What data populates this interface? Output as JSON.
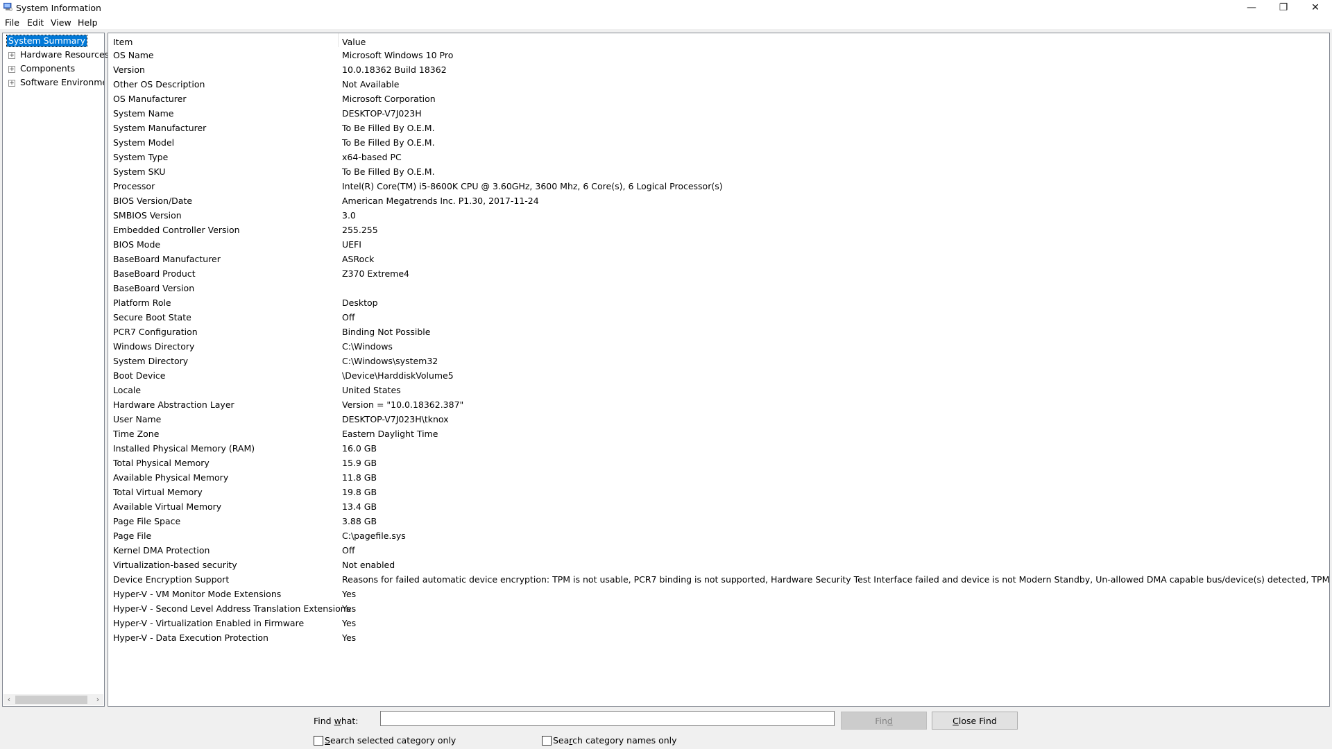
{
  "window": {
    "title": "System Information",
    "controls": {
      "minimize": "—",
      "restore": "❐",
      "close": "✕"
    }
  },
  "menu": [
    {
      "label": "File"
    },
    {
      "label": "Edit"
    },
    {
      "label": "View"
    },
    {
      "label": "Help"
    }
  ],
  "tree": {
    "selected": "System Summary",
    "items": [
      {
        "label": "Hardware Resources",
        "expander": "+"
      },
      {
        "label": "Components",
        "expander": "+"
      },
      {
        "label": "Software Environmer",
        "expander": "+"
      }
    ],
    "scroll_left": "‹",
    "scroll_right": "›"
  },
  "list": {
    "columns": {
      "item": "Item",
      "value": "Value"
    },
    "rows": [
      {
        "item": "OS Name",
        "value": "Microsoft Windows 10 Pro"
      },
      {
        "item": "Version",
        "value": "10.0.18362 Build 18362"
      },
      {
        "item": "Other OS Description",
        "value": "Not Available"
      },
      {
        "item": "OS Manufacturer",
        "value": "Microsoft Corporation"
      },
      {
        "item": "System Name",
        "value": "DESKTOP-V7J023H"
      },
      {
        "item": "System Manufacturer",
        "value": "To Be Filled By O.E.M."
      },
      {
        "item": "System Model",
        "value": "To Be Filled By O.E.M."
      },
      {
        "item": "System Type",
        "value": "x64-based PC"
      },
      {
        "item": "System SKU",
        "value": "To Be Filled By O.E.M."
      },
      {
        "item": "Processor",
        "value": "Intel(R) Core(TM) i5-8600K CPU @ 3.60GHz, 3600 Mhz, 6 Core(s), 6 Logical Processor(s)"
      },
      {
        "item": "BIOS Version/Date",
        "value": "American Megatrends Inc. P1.30, 2017-11-24"
      },
      {
        "item": "SMBIOS Version",
        "value": "3.0"
      },
      {
        "item": "Embedded Controller Version",
        "value": "255.255"
      },
      {
        "item": "BIOS Mode",
        "value": "UEFI"
      },
      {
        "item": "BaseBoard Manufacturer",
        "value": "ASRock"
      },
      {
        "item": "BaseBoard Product",
        "value": "Z370 Extreme4"
      },
      {
        "item": "BaseBoard Version",
        "value": ""
      },
      {
        "item": "Platform Role",
        "value": "Desktop"
      },
      {
        "item": "Secure Boot State",
        "value": "Off"
      },
      {
        "item": "PCR7 Configuration",
        "value": "Binding Not Possible"
      },
      {
        "item": "Windows Directory",
        "value": "C:\\Windows"
      },
      {
        "item": "System Directory",
        "value": "C:\\Windows\\system32"
      },
      {
        "item": "Boot Device",
        "value": "\\Device\\HarddiskVolume5"
      },
      {
        "item": "Locale",
        "value": "United States"
      },
      {
        "item": "Hardware Abstraction Layer",
        "value": "Version = \"10.0.18362.387\""
      },
      {
        "item": "User Name",
        "value": "DESKTOP-V7J023H\\tknox"
      },
      {
        "item": "Time Zone",
        "value": "Eastern Daylight Time"
      },
      {
        "item": "Installed Physical Memory (RAM)",
        "value": "16.0 GB"
      },
      {
        "item": "Total Physical Memory",
        "value": "15.9 GB"
      },
      {
        "item": "Available Physical Memory",
        "value": "11.8 GB"
      },
      {
        "item": "Total Virtual Memory",
        "value": "19.8 GB"
      },
      {
        "item": "Available Virtual Memory",
        "value": "13.4 GB"
      },
      {
        "item": "Page File Space",
        "value": "3.88 GB"
      },
      {
        "item": "Page File",
        "value": "C:\\pagefile.sys"
      },
      {
        "item": "Kernel DMA Protection",
        "value": "Off"
      },
      {
        "item": "Virtualization-based security",
        "value": "Not enabled"
      },
      {
        "item": "Device Encryption Support",
        "value": "Reasons for failed automatic device encryption: TPM is not usable, PCR7 binding is not supported, Hardware Security Test Interface failed and device is not Modern Standby, Un-allowed DMA capable bus/device(s) detected, TPM is not usable"
      },
      {
        "item": "Hyper-V - VM Monitor Mode Extensions",
        "value": "Yes"
      },
      {
        "item": "Hyper-V - Second Level Address Translation Extensions",
        "value": "Yes"
      },
      {
        "item": "Hyper-V - Virtualization Enabled in Firmware",
        "value": "Yes"
      },
      {
        "item": "Hyper-V - Data Execution Protection",
        "value": "Yes"
      }
    ]
  },
  "find": {
    "label_pre": "Find ",
    "label_accel": "w",
    "label_post": "hat:",
    "input_value": "",
    "find_button": {
      "pre": "Fin",
      "accel": "d",
      "post": "",
      "enabled": false
    },
    "close_button": {
      "pre": "",
      "accel": "C",
      "post": "lose Find"
    },
    "checkbox_selected_category": {
      "pre": "",
      "accel": "S",
      "post": "earch selected category only",
      "checked": false
    },
    "checkbox_category_names": {
      "pre": "Sea",
      "accel": "r",
      "post": "ch category names only",
      "checked": false
    }
  }
}
